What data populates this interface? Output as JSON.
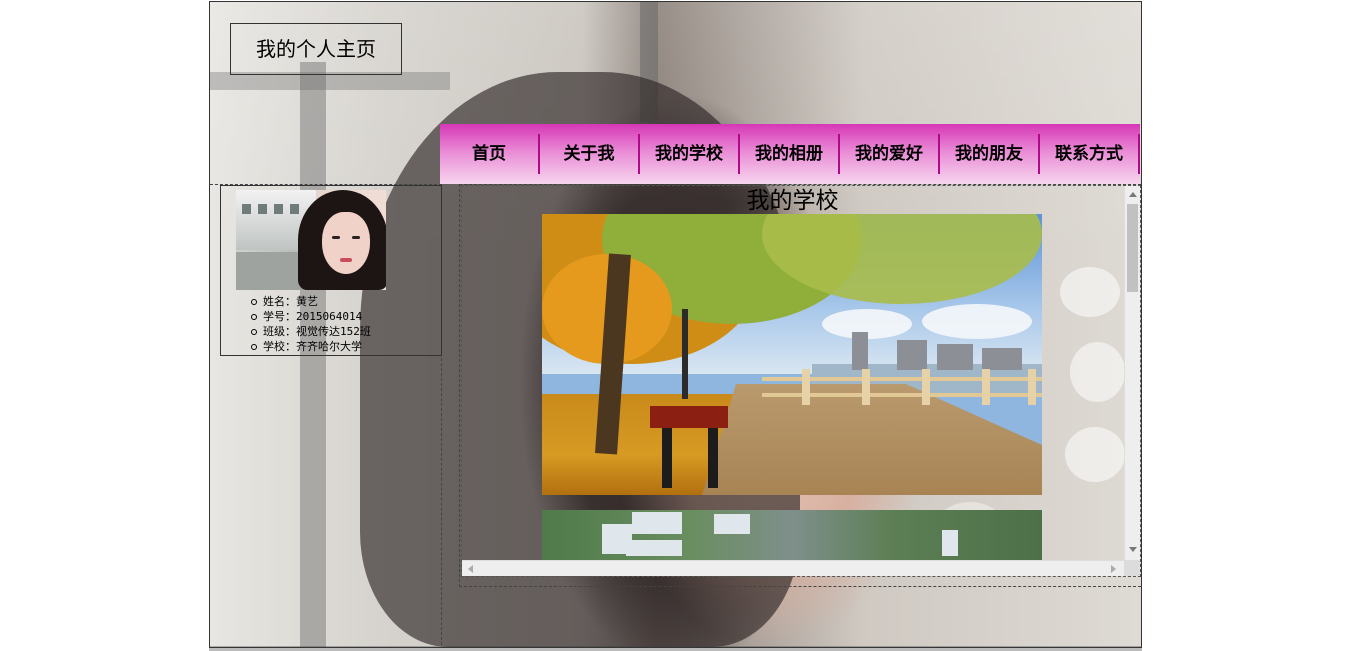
{
  "site": {
    "title": "我的个人主页"
  },
  "nav": {
    "items": [
      {
        "label": "首页"
      },
      {
        "label": "关于我"
      },
      {
        "label": "我的学校"
      },
      {
        "label": "我的相册"
      },
      {
        "label": "我的爱好"
      },
      {
        "label": "我的朋友"
      },
      {
        "label": "联系方式"
      }
    ],
    "gradient_top": "#d637b6",
    "gradient_bottom": "#f7d6ef"
  },
  "profile": {
    "info": [
      {
        "text": "姓名：黄艺"
      },
      {
        "text": "学号：2015064014"
      },
      {
        "text": "班级：视觉传达152班"
      },
      {
        "text": "学校：齐齐哈尔大学"
      }
    ]
  },
  "content": {
    "title": "我的学校"
  }
}
